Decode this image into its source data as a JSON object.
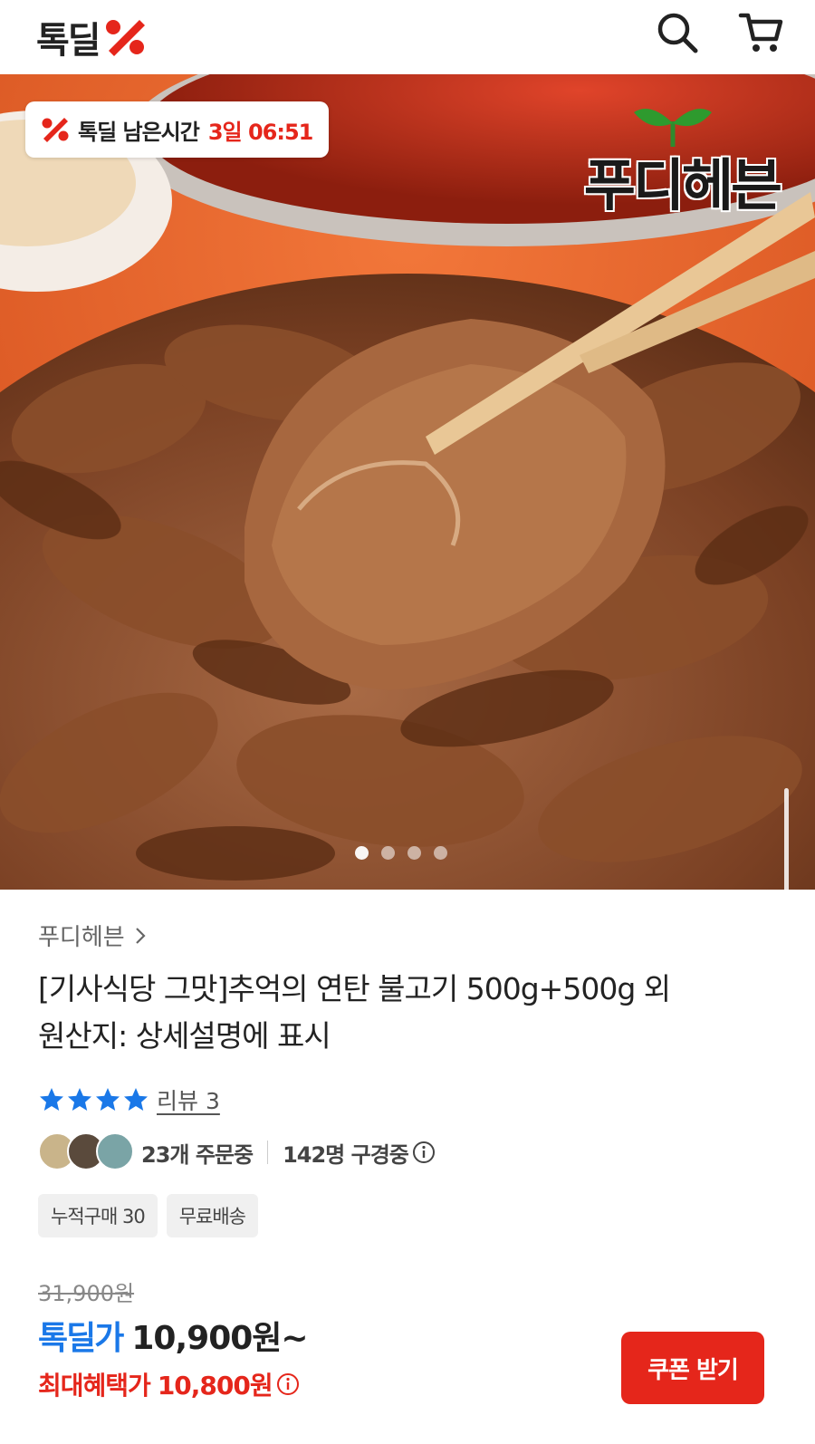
{
  "header": {
    "logo_text": "톡딜",
    "search_icon": "search-icon",
    "cart_icon": "cart-icon"
  },
  "hero": {
    "timer_label": "톡딜 남은시간",
    "timer_value": "3일 06:51",
    "brand_logo_text": "푸디헤븐",
    "slides_count": 4,
    "active_slide": 1
  },
  "product": {
    "seller": "푸디헤븐",
    "title": "[기사식당 그맛]추억의 연탄 불고기 500g+500g 외",
    "origin": "원산지: 상세설명에 표시",
    "rating_stars": 4,
    "review_label": "리뷰 3",
    "orders_text": "23개 주문중",
    "viewers_text": "142명 구경중",
    "tags": [
      "누적구매 30",
      "무료배송"
    ]
  },
  "pricing": {
    "original_price": "31,900원",
    "deal_label": "톡딜가",
    "deal_price": "10,900원~",
    "max_benefit_label": "최대혜택가",
    "max_benefit_price": "10,800원",
    "coupon_button": "쿠폰 받기"
  },
  "colors": {
    "brand_red": "#e5261b",
    "deal_blue": "#1a78e8",
    "star_blue": "#1a78e8"
  }
}
